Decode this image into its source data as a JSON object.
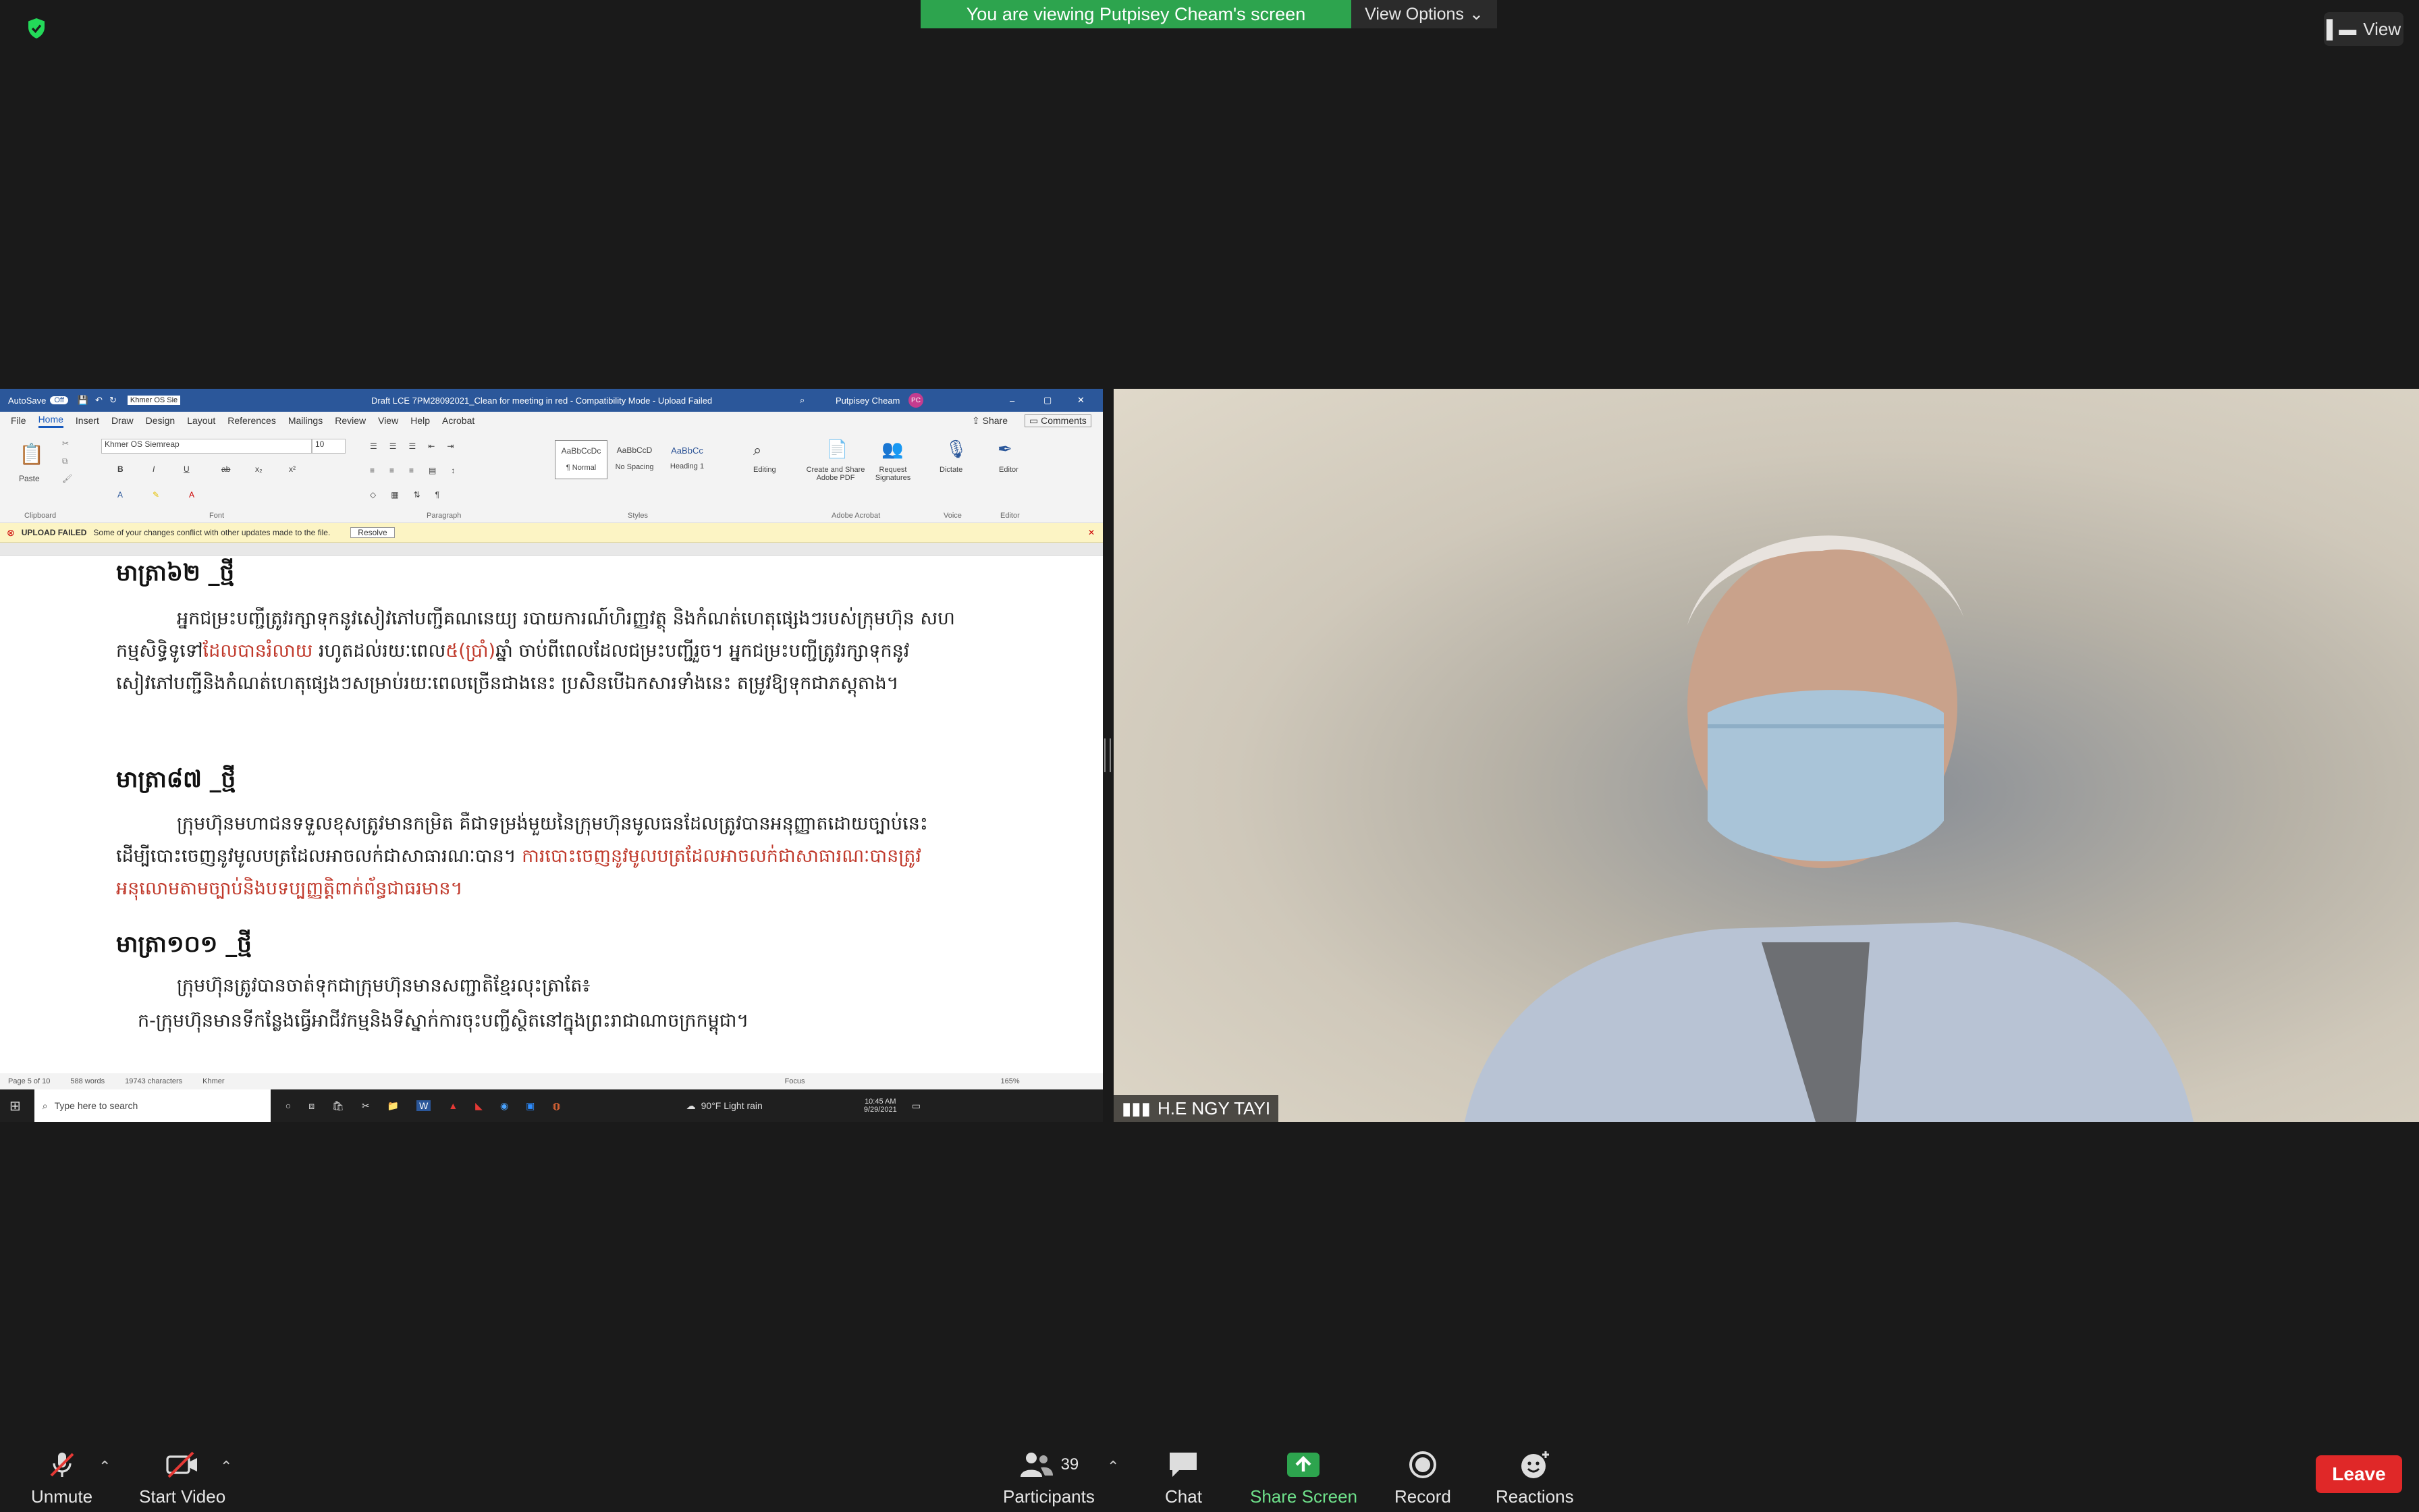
{
  "zoom": {
    "banner_text": "You are viewing Putpisey Cheam's screen",
    "view_options": "View Options",
    "view_button": "View",
    "participant_name": "H.E NGY TAYI",
    "participant_count": "39",
    "toolbar": {
      "unmute": "Unmute",
      "start_video": "Start Video",
      "participants": "Participants",
      "chat": "Chat",
      "share_screen": "Share Screen",
      "record": "Record",
      "reactions": "Reactions",
      "leave": "Leave"
    },
    "colors": {
      "banner": "#2da44e",
      "leave": "#e02828",
      "share": "#2da44e"
    }
  },
  "word": {
    "autosave": "AutoSave",
    "autosave_state": "Off",
    "font_quick": "Khmer OS Sie",
    "title": "Draft LCE 7PM28092021_Clean for meeting in red  -  Compatibility Mode  -  Upload Failed",
    "user": "Putpisey Cheam",
    "user_initials": "PC",
    "tabs": [
      "File",
      "Home",
      "Insert",
      "Draw",
      "Design",
      "Layout",
      "References",
      "Mailings",
      "Review",
      "View",
      "Help",
      "Acrobat"
    ],
    "share": "Share",
    "comments": "Comments",
    "ribbon": {
      "paste": "Paste",
      "clipboard": "Clipboard",
      "font_name": "Khmer OS Siemreap",
      "font_size": "10",
      "font": "Font",
      "paragraph": "Paragraph",
      "styles_label": "Styles",
      "styles": [
        {
          "preview": "AaBbCcDc",
          "name": "¶ Normal"
        },
        {
          "preview": "AaBbCcD",
          "name": "No Spacing"
        },
        {
          "preview": "AaBbCc",
          "name": "Heading 1"
        }
      ],
      "editing": "Editing",
      "create_pdf": "Create and Share Adobe PDF",
      "request_sig": "Request Signatures",
      "acrobat": "Adobe Acrobat",
      "dictate": "Dictate",
      "voice": "Voice",
      "editor": "Editor",
      "editor_group": "Editor"
    },
    "message": {
      "title": "UPLOAD FAILED",
      "text": "Some of your changes conflict with other updates made to the file.",
      "button": "Resolve"
    },
    "doc": {
      "h1": "មាត្រា៦២ _ថ្មី",
      "p1a": "អ្នកជម្រះបញ្ជីត្រូវរក្សាទុកនូវសៀវភៅបញ្ជីគណនេយ្យ របាយការណ៍ហិរញ្ញវត្ថុ និងកំណត់ហេតុផ្សេងៗរបស់ក្រុមហ៊ុន សហកម្មសិទ្ធិទូទៅ",
      "p1b": "ដែលបានរំលាយ",
      "p1c": " រហូតដល់រយៈពេល",
      "p1d": "៥(ប្រាំ)",
      "p1e": "ឆ្នាំ ចាប់ពីពេលដែលជម្រះបញ្ជីរួច។ អ្នកជម្រះបញ្ជីត្រូវរក្សាទុកនូវសៀវភៅបញ្ជីនិងកំណត់ហេតុផ្សេងៗសម្រាប់រយៈពេលច្រើនជាងនេះ ប្រសិនបើឯកសារទាំងនេះ តម្រូវឱ្យទុកជាភស្តុតាង។",
      "h2": "មាត្រា៨៧ _ថ្មី",
      "p2a": "ក្រុមហ៊ុនមហាជនទទួលខុសត្រូវមានកម្រិត គឺជាទម្រង់មួយនៃក្រុមហ៊ុនមូលធនដែលត្រូវបានអនុញ្ញាតដោយច្បាប់នេះ ដើម្បីបោះចេញនូវមូលបត្រដែលអាចលក់ជាសាធារណៈបាន។ ",
      "p2b": "ការបោះចេញនូវមូលបត្រដែលអាចលក់ជាសាធារណៈបានត្រូវអនុលោមតាមច្បាប់និងបទប្បញ្ញត្តិពាក់ព័ន្ធជាធរមាន។",
      "h3": "មាត្រា១០១ _ថ្មី",
      "p3": "ក្រុមហ៊ុនត្រូវបានចាត់ទុកជាក្រុមហ៊ុនមានសញ្ជាតិខ្មែរលុះត្រាតែ៖",
      "p4": "ក-ក្រុមហ៊ុនមានទីកន្លែងធ្វើអាជីវកម្មនិងទីស្នាក់ការចុះបញ្ជីស្ថិតនៅក្នុងព្រះរាជាណាចក្រកម្ពុជា។"
    },
    "status": {
      "page": "Page 5 of 10",
      "words": "588 words",
      "chars": "19743 characters",
      "lang": "Khmer",
      "focus": "Focus",
      "zoom": "165%"
    },
    "taskbar": {
      "search": "Type here to search",
      "weather": "90°F  Light rain",
      "time": "10:45 AM",
      "date": "9/29/2021"
    }
  }
}
